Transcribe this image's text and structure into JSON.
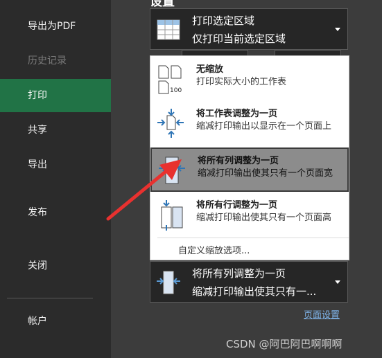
{
  "sidebar": {
    "items": [
      {
        "label": "导出为PDF",
        "state": "normal"
      },
      {
        "label": "历史记录",
        "state": "disabled"
      },
      {
        "label": "打印",
        "state": "active"
      },
      {
        "label": "共享",
        "state": "normal"
      },
      {
        "label": "导出",
        "state": "normal"
      },
      {
        "label": "发布",
        "state": "normal"
      },
      {
        "label": "关闭",
        "state": "normal"
      },
      {
        "label": "帐户",
        "state": "normal"
      }
    ]
  },
  "main": {
    "heading": "设置",
    "print_area": {
      "title": "打印选定区域",
      "subtitle": "仅打印当前选定区域"
    },
    "scaling_current": {
      "title": "将所有列调整为一页",
      "subtitle": "缩减打印输出使其只有一..."
    },
    "page_setup_link": "页面设置"
  },
  "dropdown": {
    "options": [
      {
        "title": "无缩放",
        "desc": "打印实际大小的工作表",
        "icon": "no-scaling-icon",
        "icon_label": "100"
      },
      {
        "title": "将工作表调整为一页",
        "desc": "缩减打印输出以显示在一个页面上",
        "icon": "fit-sheet-icon"
      },
      {
        "title": "将所有列调整为一页",
        "desc": "缩减打印输出使其只有一个页面宽",
        "icon": "fit-columns-icon"
      },
      {
        "title": "将所有行调整为一页",
        "desc": "缩减打印输出使其只有一个页面高",
        "icon": "fit-rows-icon"
      }
    ],
    "custom_label": "自定义缩放选项..."
  },
  "watermark": "CSDN @阿巴阿巴啊啊啊",
  "colors": {
    "accent": "#217346",
    "sidebar": "#2b2b2b",
    "arrow": "#e8312f",
    "icon_blue": "#2e75b6"
  }
}
